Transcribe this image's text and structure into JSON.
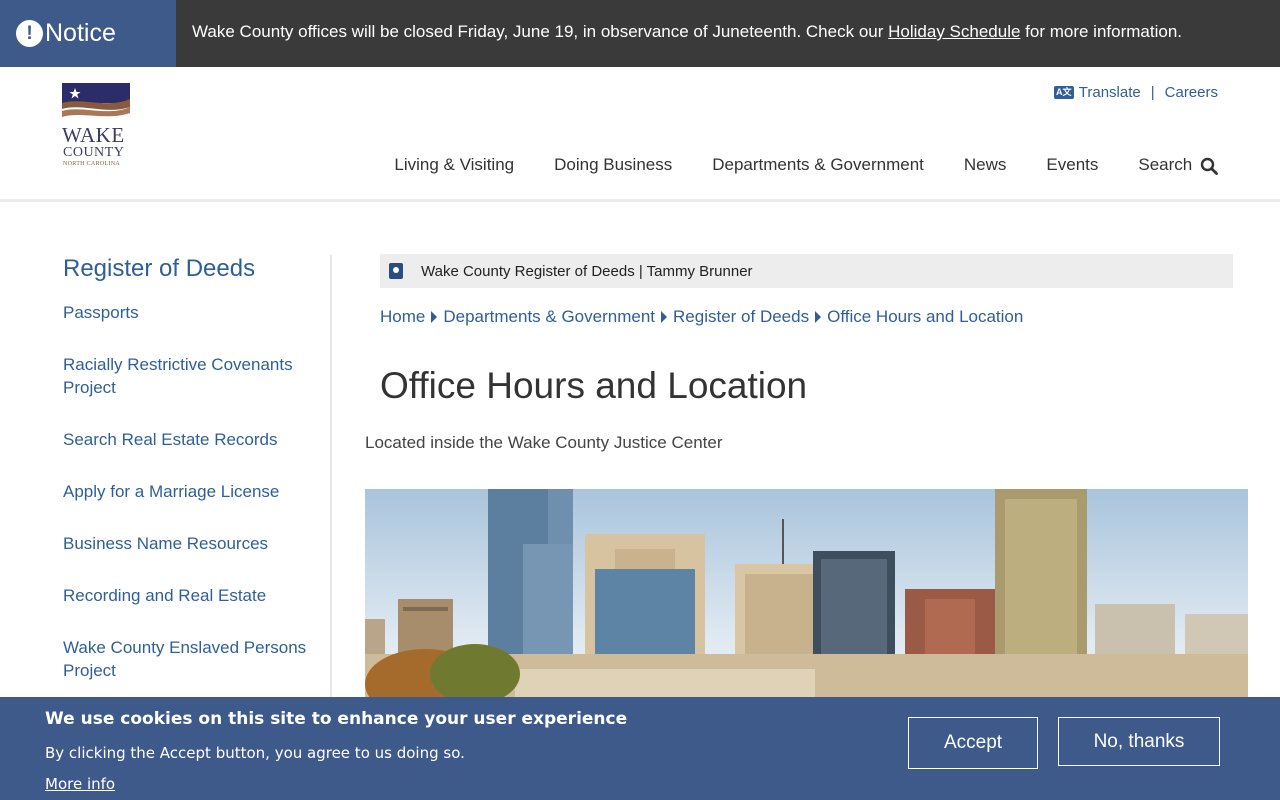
{
  "notice": {
    "label": "Notice",
    "text_before": "Wake County offices will be closed Friday, June 19, in observance of Juneteenth. Check our ",
    "link": "Holiday Schedule",
    "text_after": " for more information."
  },
  "logo": {
    "line1": "WAKE",
    "line2": "COUNTY",
    "line3": "NORTH CAROLINA"
  },
  "utility": {
    "translate_icon": "A文",
    "translate": "Translate",
    "separator": "|",
    "careers": "Careers"
  },
  "nav": {
    "items": [
      {
        "label": "Living & Visiting"
      },
      {
        "label": "Doing Business"
      },
      {
        "label": "Departments & Government"
      },
      {
        "label": "News"
      },
      {
        "label": "Events"
      },
      {
        "label": "Search"
      }
    ]
  },
  "sidebar": {
    "title": "Register of Deeds",
    "items": [
      {
        "label": "Passports"
      },
      {
        "label": "Racially Restrictive Covenants Project"
      },
      {
        "label": "Search Real Estate Records"
      },
      {
        "label": "Apply for a Marriage License"
      },
      {
        "label": "Business Name Resources"
      },
      {
        "label": "Recording and Real Estate"
      },
      {
        "label": "Wake County Enslaved Persons Project"
      }
    ]
  },
  "site_bar": {
    "text": "Wake County Register of Deeds | Tammy Brunner"
  },
  "breadcrumb": {
    "items": [
      {
        "label": "Home"
      },
      {
        "label": "Departments & Government"
      },
      {
        "label": "Register of Deeds"
      },
      {
        "label": "Office Hours and Location"
      }
    ]
  },
  "page": {
    "title": "Office Hours and Location",
    "intro": "Located inside the Wake County Justice Center"
  },
  "cookie": {
    "title": "We use cookies on this site to enhance your user experience",
    "text": "By clicking the Accept button, you agree to us doing so.",
    "more": "More info",
    "accept": "Accept",
    "decline": "No, thanks"
  },
  "colors": {
    "brand_blue": "#3d5a8a",
    "link_blue": "#2f5f98",
    "notice_bg": "#3a3a3a"
  },
  "icons": {
    "notice": "exclamation-circle-icon",
    "translate": "translate-icon",
    "search": "magnifier-icon",
    "site_bar": "id-card-icon",
    "breadcrumb_separator": "caret-right-icon"
  }
}
